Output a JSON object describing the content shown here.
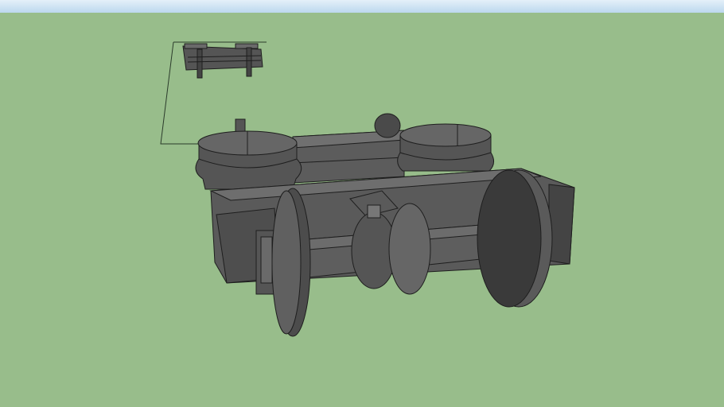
{
  "viewport": {
    "background_color": "#98bd8b",
    "sky_color": "#cfe3f3",
    "model_face_color": "#5a5a5a",
    "model_dark_color": "#3a3a3a",
    "model_light_color": "#707070",
    "edge_color": "#1e1e1e"
  }
}
